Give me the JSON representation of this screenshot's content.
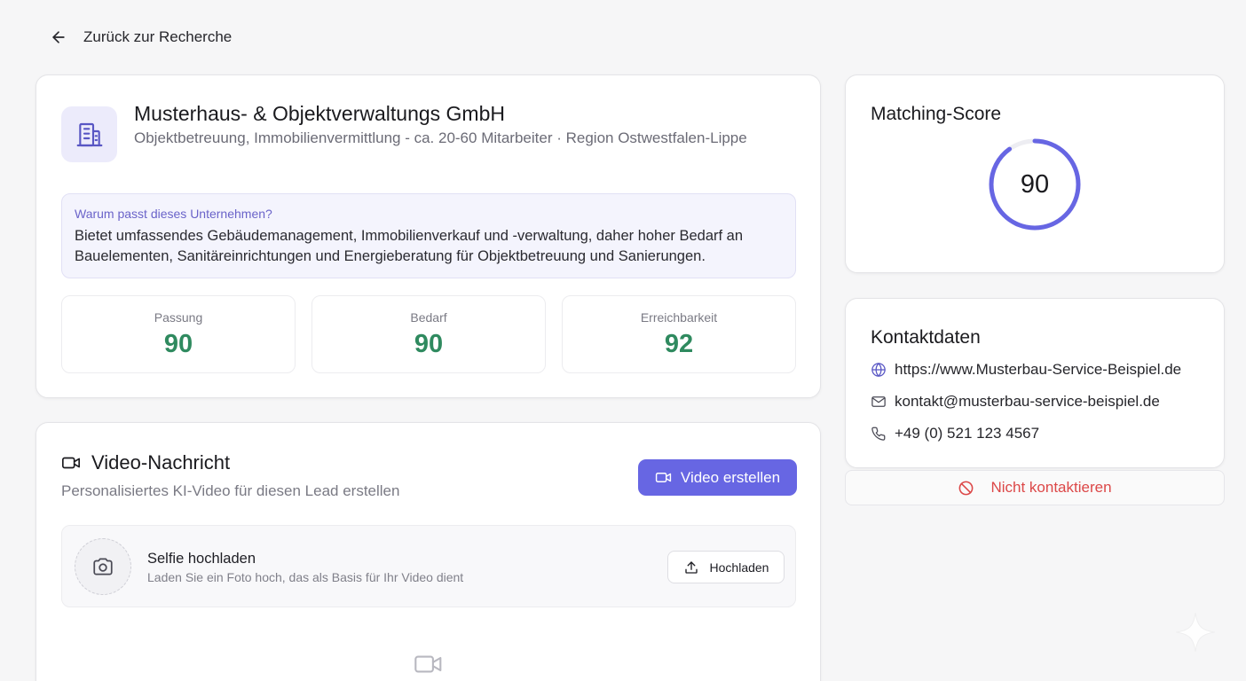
{
  "nav": {
    "back_label": "Zurück zur Recherche"
  },
  "company": {
    "name": "Musterhaus- & Objektverwaltungs GmbH",
    "subtitle": "Objektbetreuung, Immobilienvermittlung - ca. 20-60 Mitarbeiter · Region Ostwestfalen-Lippe",
    "icon": "building-icon",
    "why_label": "Warum passt dieses Unternehmen?",
    "why_text": "Bietet umfassendes Gebäudemanagement, Immobilienverkauf und -verwaltung, daher hoher Bedarf an Bauelementen, Sanitäreinrichtungen und Energieberatung für Objektbetreuung und Sanierungen.",
    "metrics": [
      {
        "label": "Passung",
        "value": "90"
      },
      {
        "label": "Bedarf",
        "value": "90"
      },
      {
        "label": "Erreichbarkeit",
        "value": "92"
      }
    ]
  },
  "video": {
    "title": "Video-Nachricht",
    "subtitle": "Personalisiertes KI-Video für diesen Lead erstellen",
    "create_button": "Video erstellen",
    "selfie_title": "Selfie hochladen",
    "selfie_sub": "Laden Sie ein Foto hoch, das als Basis für Ihr Video dient",
    "upload_button": "Hochladen"
  },
  "score": {
    "title": "Matching-Score",
    "value": "90",
    "fraction": 0.9
  },
  "contact": {
    "title": "Kontaktdaten",
    "website": "https://www.Musterbau-Service-Beispiel.de",
    "email": "kontakt@musterbau-service-beispiel.de",
    "phone": "+49 (0) 521 123 4567"
  },
  "actions": {
    "do_not_contact": "Nicht kontaktieren"
  },
  "colors": {
    "accent": "#6766e3",
    "positive": "#2f8a5f",
    "danger": "#dc4848"
  }
}
